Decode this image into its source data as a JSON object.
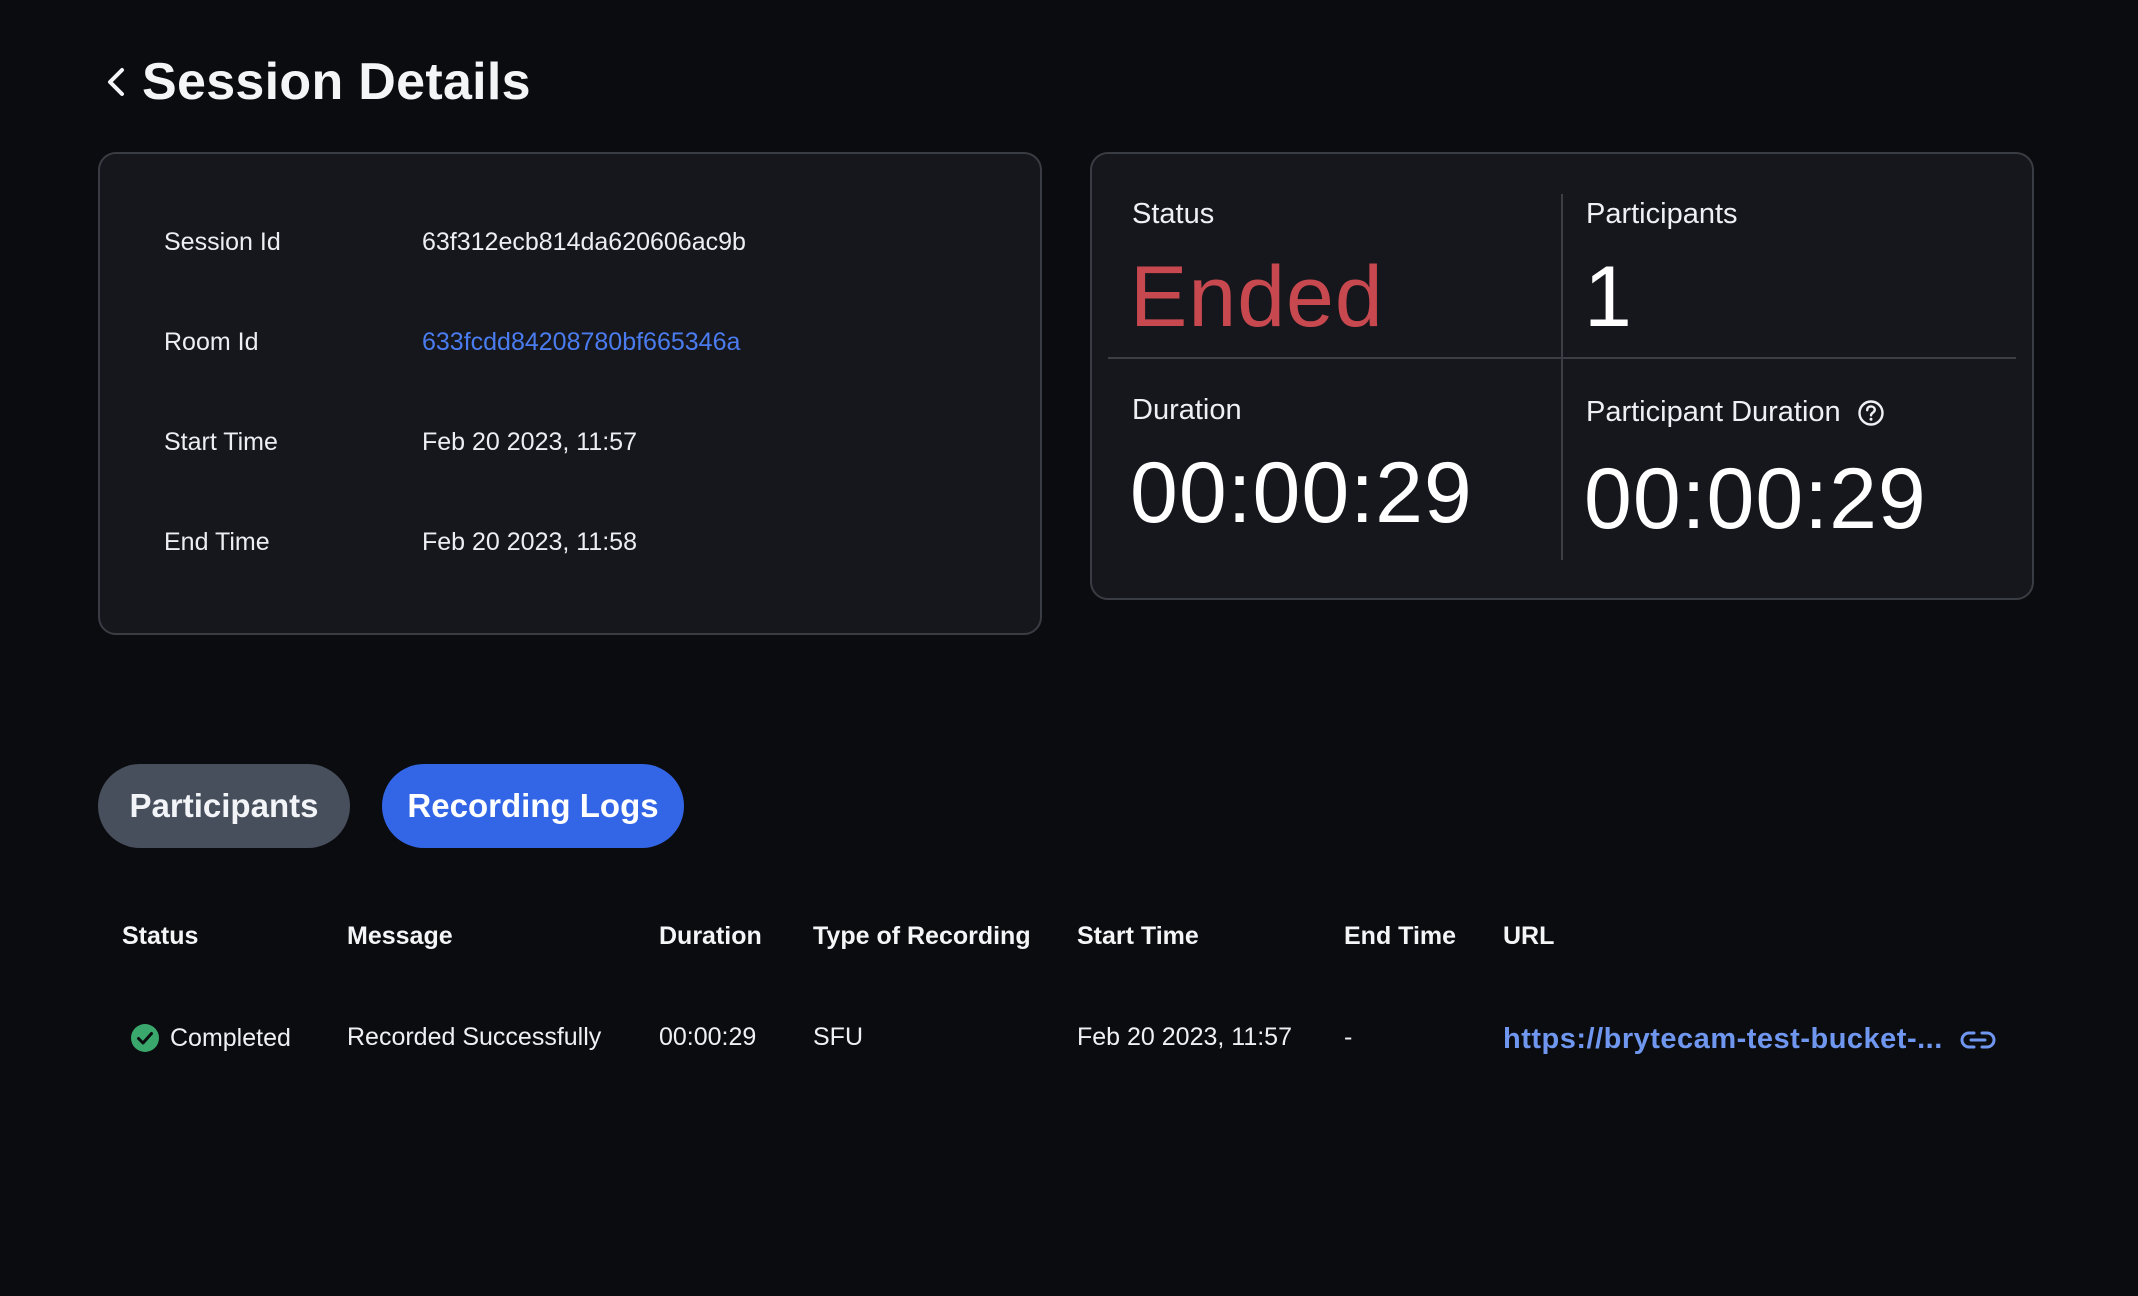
{
  "header": {
    "title": "Session Details"
  },
  "session_info": {
    "rows": [
      {
        "label": "Session Id",
        "value": "63f312ecb814da620606ac9b"
      },
      {
        "label": "Room Id",
        "value": "633fcdd84208780bf665346a"
      },
      {
        "label": "Start Time",
        "value": "Feb 20 2023, 11:57"
      },
      {
        "label": "End Time",
        "value": "Feb 20 2023, 11:58"
      }
    ]
  },
  "stats": {
    "status_label": "Status",
    "status_value": "Ended",
    "participants_label": "Participants",
    "participants_value": "1",
    "duration_label": "Duration",
    "duration_value": "00:00:29",
    "participant_duration_label": "Participant Duration",
    "participant_duration_value": "00:00:29"
  },
  "tabs": [
    {
      "label": "Participants",
      "active": false
    },
    {
      "label": "Recording Logs",
      "active": true
    }
  ],
  "table": {
    "columns": [
      "Status",
      "Message",
      "Duration",
      "Type of Recording",
      "Start Time",
      "End Time",
      "URL"
    ],
    "rows": [
      {
        "status": "Completed",
        "message": "Recorded Successfully",
        "duration": "00:00:29",
        "type": "SFU",
        "start_time": "Feb 20 2023, 11:57",
        "end_time": "-",
        "url": "https://brytecam-test-bucket-..."
      }
    ]
  },
  "colors": {
    "background": "#0b0c0f",
    "card": "#16171c",
    "status_ended": "#c8484f",
    "link": "#4a7cf0",
    "tab_active": "#3366e6",
    "tab_inactive": "#474f5d",
    "success": "#3aa76d"
  },
  "icons": {
    "back": "chevron-left-icon",
    "help": "question-circle-icon",
    "status_completed": "check-circle-icon",
    "url_link": "link-icon"
  }
}
